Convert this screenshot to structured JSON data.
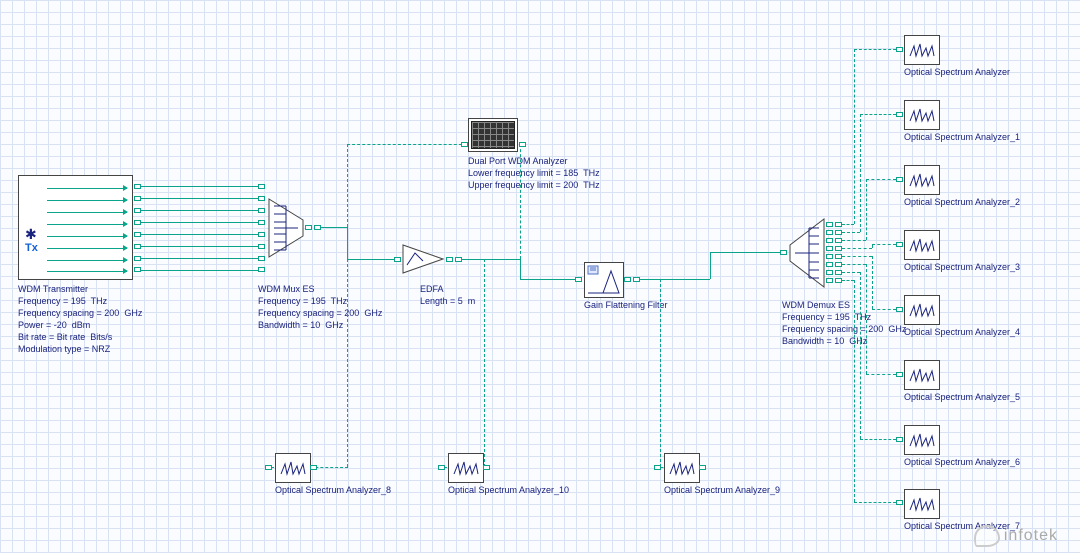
{
  "blocks": {
    "wdm_tx": {
      "title": "WDM Transmitter",
      "params": [
        "Frequency = 195  THz",
        "Frequency spacing = 200  GHz",
        "Power = -20  dBm",
        "Bit rate = Bit rate  Bits/s",
        "Modulation type = NRZ"
      ]
    },
    "wdm_mux": {
      "title": "WDM Mux ES",
      "params": [
        "Frequency = 195  THz",
        "Frequency spacing = 200  GHz",
        "Bandwidth = 10  GHz"
      ]
    },
    "edfa": {
      "title": "EDFA",
      "params": [
        "Length = 5  m"
      ]
    },
    "dpa": {
      "title": "Dual Port WDM Analyzer",
      "params": [
        "Lower frequency limit = 185  THz",
        "Upper frequency limit = 200  THz"
      ]
    },
    "gff": {
      "title": "Gain Flattening Filter",
      "params": []
    },
    "wdm_demux": {
      "title": "WDM Demux ES",
      "params": [
        "Frequency = 195  THz",
        "Frequency spacing = 200  GHz",
        "Bandwidth = 10  GHz"
      ]
    },
    "osa_right": [
      "Optical Spectrum Analyzer",
      "Optical Spectrum Analyzer_1",
      "Optical Spectrum Analyzer_2",
      "Optical Spectrum Analyzer_3",
      "Optical Spectrum Analyzer_4",
      "Optical Spectrum Analyzer_5",
      "Optical Spectrum Analyzer_6",
      "Optical Spectrum Analyzer_7"
    ],
    "osa_bottom": {
      "osa8": "Optical Spectrum Analyzer_8",
      "osa10": "Optical Spectrum Analyzer_10",
      "osa9": "Optical Spectrum Analyzer_9"
    }
  },
  "watermark": "infotek"
}
